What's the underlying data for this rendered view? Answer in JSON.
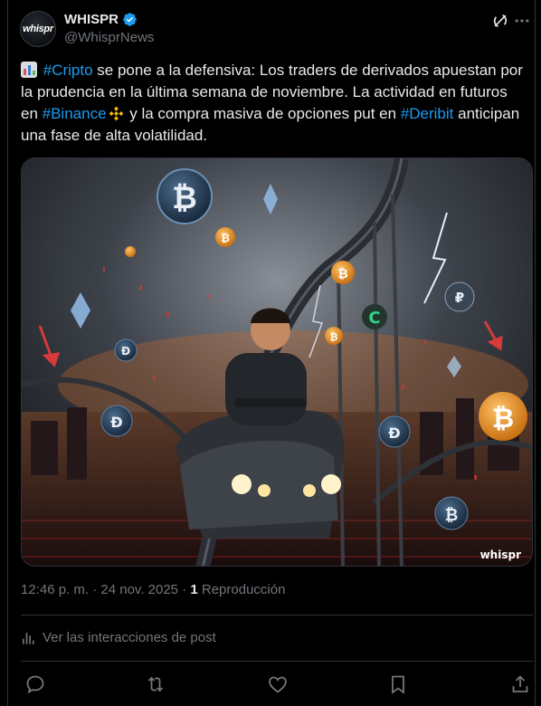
{
  "author": {
    "avatar_text": "whispr",
    "display_name": "WHISPR",
    "handle": "@WhisprNews",
    "verified": true
  },
  "post": {
    "emoji": "bar-chart-emoji",
    "hashtag_cripto": "#Cripto",
    "text_1": " se pone a la defensiva: Los traders de derivados apuestan por la prudencia en la última semana de noviembre. La actividad en futuros en ",
    "hashtag_binance": "#Binance",
    "text_2": " y la compra masiva de opciones put en ",
    "hashtag_deribit": "#Deribit",
    "text_3": " anticipan una fase de alta volatilidad."
  },
  "media": {
    "watermark": "whispr",
    "description_icon": "rollercoaster-crypto-illustration"
  },
  "meta": {
    "time": "12:46 p. m.",
    "separator": " · ",
    "date": "24 nov. 2025",
    "separator2": " · ",
    "views_count": "1",
    "views_label": " Reproducción"
  },
  "analytics": {
    "label": "Ver las interacciones de post"
  },
  "colors": {
    "accent": "#1d9bf0",
    "background": "#000000",
    "muted": "#71767b",
    "text": "#e7e9ea",
    "divider": "#2f3336"
  }
}
